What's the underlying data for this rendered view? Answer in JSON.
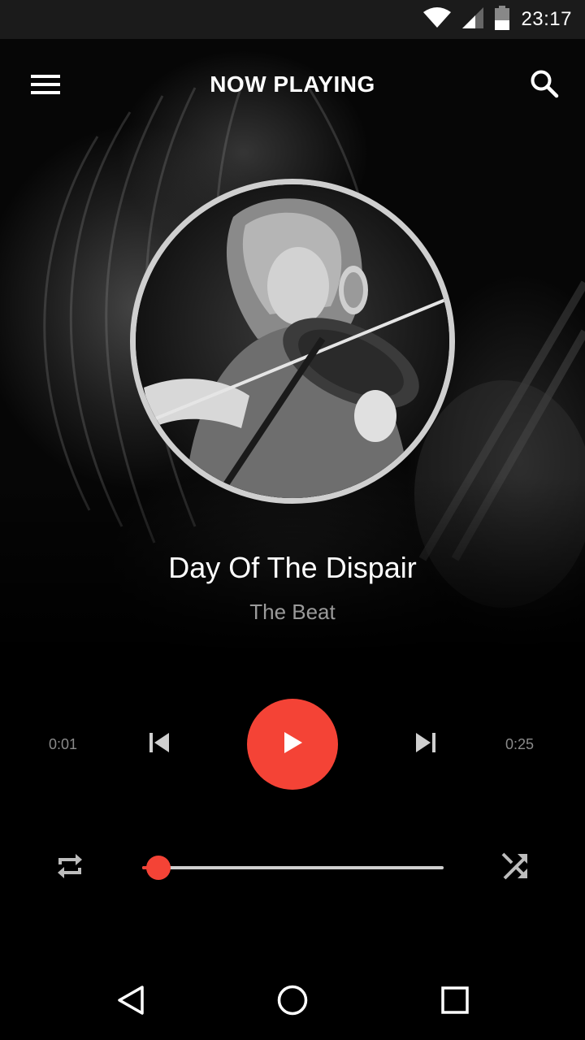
{
  "status_bar": {
    "time": "23:17",
    "icons": [
      "wifi-icon",
      "cellular-signal-icon",
      "battery-icon"
    ]
  },
  "app_bar": {
    "title": "NOW PLAYING",
    "menu_icon": "hamburger-menu-icon",
    "search_icon": "search-icon"
  },
  "track": {
    "title": "Day Of The Dispair",
    "artist": "The Beat",
    "artwork": "album-art"
  },
  "player": {
    "elapsed": "0:01",
    "total": "0:25",
    "progress_fraction": 0.055,
    "state": "paused",
    "controls": {
      "previous_icon": "skip-previous-icon",
      "play_icon": "play-icon",
      "next_icon": "skip-next-icon",
      "repeat_icon": "repeat-icon",
      "shuffle_icon": "shuffle-icon"
    }
  },
  "nav_bar": {
    "icons": [
      "back-icon",
      "home-icon",
      "recents-icon"
    ]
  },
  "colors": {
    "accent": "#f44336",
    "background": "#000000",
    "status_bar": "#1b1b1b",
    "secondary_text": "#9a9a9a",
    "artwork_ring": "#cfcfcf"
  }
}
